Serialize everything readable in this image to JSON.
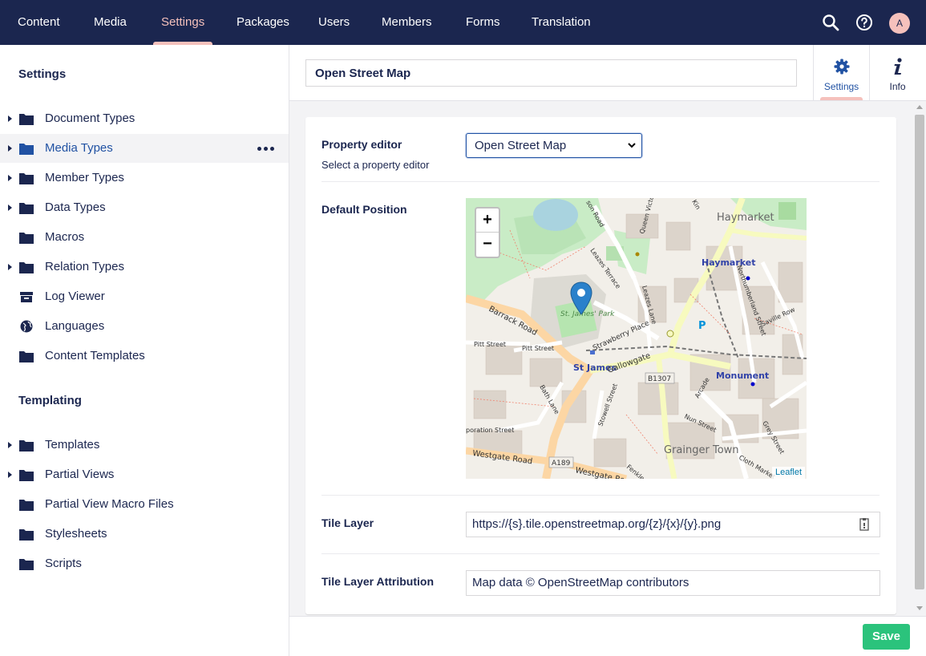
{
  "topnav": {
    "items": [
      "Content",
      "Media",
      "Settings",
      "Packages",
      "Users",
      "Members",
      "Forms",
      "Translation"
    ],
    "active": "Settings",
    "avatar_initial": "A"
  },
  "sidebar": {
    "sections": [
      {
        "title": "Settings",
        "items": [
          {
            "label": "Document Types",
            "icon": "folder-icon",
            "expandable": true
          },
          {
            "label": "Media Types",
            "icon": "folder-icon",
            "expandable": true,
            "selected": true
          },
          {
            "label": "Member Types",
            "icon": "folder-icon",
            "expandable": true
          },
          {
            "label": "Data Types",
            "icon": "folder-icon",
            "expandable": true
          },
          {
            "label": "Macros",
            "icon": "folder-icon",
            "expandable": false
          },
          {
            "label": "Relation Types",
            "icon": "folder-icon",
            "expandable": true
          },
          {
            "label": "Log Viewer",
            "icon": "box-icon",
            "expandable": false
          },
          {
            "label": "Languages",
            "icon": "globe-icon",
            "expandable": false
          },
          {
            "label": "Content Templates",
            "icon": "folder-icon",
            "expandable": false
          }
        ]
      },
      {
        "title": "Templating",
        "items": [
          {
            "label": "Templates",
            "icon": "folder-icon",
            "expandable": true
          },
          {
            "label": "Partial Views",
            "icon": "folder-icon",
            "expandable": true
          },
          {
            "label": "Partial View Macro Files",
            "icon": "folder-icon",
            "expandable": false
          },
          {
            "label": "Stylesheets",
            "icon": "folder-icon",
            "expandable": false
          },
          {
            "label": "Scripts",
            "icon": "folder-icon",
            "expandable": false
          }
        ]
      }
    ]
  },
  "editor": {
    "name": "Open Street Map",
    "apps": [
      {
        "label": "Settings",
        "icon": "gear-icon",
        "active": true
      },
      {
        "label": "Info",
        "icon": "info-icon",
        "active": false
      }
    ],
    "properties": {
      "property_editor": {
        "label": "Property editor",
        "description": "Select a property editor",
        "value": "Open Street Map"
      },
      "default_position": {
        "label": "Default Position"
      },
      "tile_layer": {
        "label": "Tile Layer",
        "value": "https://{s}.tile.openstreetmap.org/{z}/{x}/{y}.png"
      },
      "tile_layer_attribution": {
        "label": "Tile Layer Attribution",
        "value": "Map data © OpenStreetMap contributors"
      }
    },
    "map": {
      "zoom_in": "+",
      "zoom_out": "−",
      "attribution": "Leaflet",
      "labels": {
        "haymarket_area": "Haymarket",
        "haymarket_station": "Haymarket",
        "st_james_park": "St. James' Park",
        "st_james": "St James",
        "monument": "Monument",
        "grainger_town": "Grainger Town",
        "barrack_road": "Barrack Road",
        "gallowgate": "Gallowgate",
        "strawberry_place": "Strawberry Place",
        "pitt_street_1": "Pitt Street",
        "pitt_street_2": "Pitt Street",
        "bath_lane": "Bath Lane",
        "stowell_street": "Stowell Street",
        "westgate_road_1": "Westgate Road",
        "westgate_road_2": "Westgate Road",
        "a189": "A189",
        "b1307": "B1307",
        "leazes_terrace": "Leazes Terrace",
        "leazes_lane": "Leazes Lane",
        "northumberland_street": "Northumberland Street",
        "saville_row": "Saville Row",
        "arcade": "Arcade",
        "nun_street": "Nun Street",
        "grey_street": "Grey Street",
        "cloth_market": "Cloth Market",
        "corporation_street": "poration Street",
        "son_road": "son Road",
        "queen_victoria": "Queen Victo",
        "fenkle": "Fenkle",
        "kin": "Kin",
        "parking": "P"
      }
    }
  },
  "footer": {
    "save_label": "Save"
  },
  "colors": {
    "nav_bg": "#1b264f",
    "accent": "#f5c1bc",
    "save": "#2bc37c",
    "link": "#2152a3"
  }
}
